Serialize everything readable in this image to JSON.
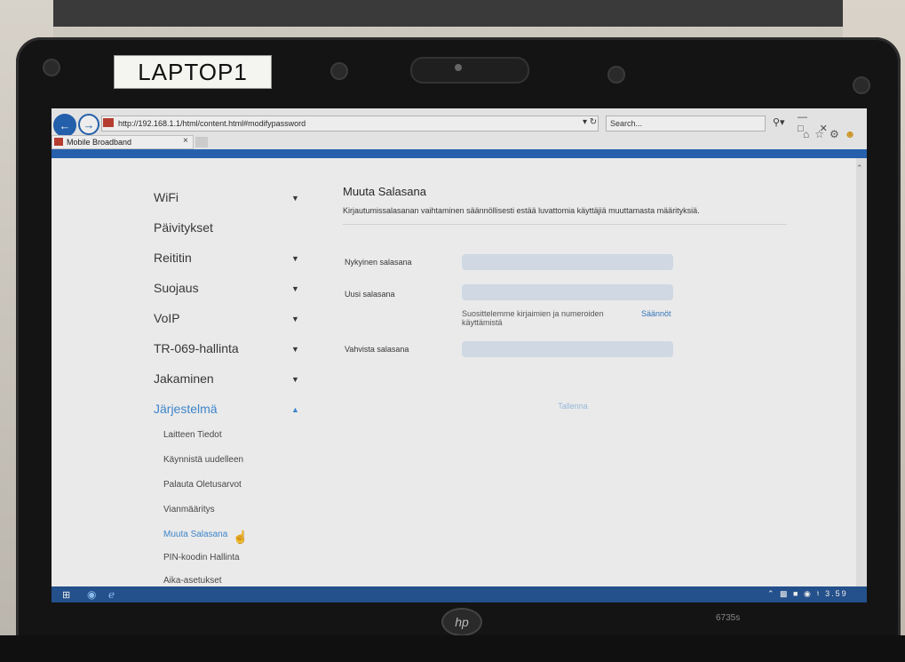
{
  "sticker_label": "LAPTOP1",
  "browser": {
    "url": "http://192.168.1.1/html/content.html#modifypassword",
    "search_placeholder": "Search...",
    "tab_title": "Mobile Broadband",
    "tab_close": "×"
  },
  "sidebar": {
    "items": [
      {
        "label": "WiFi",
        "expanded": false
      },
      {
        "label": "Päivitykset",
        "expanded": null
      },
      {
        "label": "Reititin",
        "expanded": false
      },
      {
        "label": "Suojaus",
        "expanded": false
      },
      {
        "label": "VoIP",
        "expanded": false
      },
      {
        "label": "TR-069-hallinta",
        "expanded": false
      },
      {
        "label": "Jakaminen",
        "expanded": false
      },
      {
        "label": "Järjestelmä",
        "expanded": true
      }
    ],
    "sub_items": [
      "Laitteen Tiedot",
      "Käynnistä uudelleen",
      "Palauta Oletusarvot",
      "Vianmääritys",
      "Muuta Salasana",
      "PIN-koodin Hallinta",
      "Aika-asetukset"
    ],
    "active_sub_item": "Muuta Salasana"
  },
  "main": {
    "title": "Muuta Salasana",
    "description": "Kirjautumissalasanan vaihtaminen säännöllisesti estää luvattomia käyttäjiä muuttamasta määrityksiä.",
    "current_password_label": "Nykyinen salasana",
    "new_password_label": "Uusi salasana",
    "hint": "Suosittelemme kirjaimien ja numeroiden käyttämistä",
    "rules_link": "Säännöt",
    "confirm_password_label": "Vahvista salasana",
    "save_button": "Tallenna"
  },
  "taskbar": {
    "clock": "3.59"
  },
  "laptop": {
    "brand": "hp",
    "model": "6735s"
  },
  "colors": {
    "accent": "#3a8ad6",
    "header_bar": "#1f5fb6",
    "input_bg": "#dde7f3"
  }
}
